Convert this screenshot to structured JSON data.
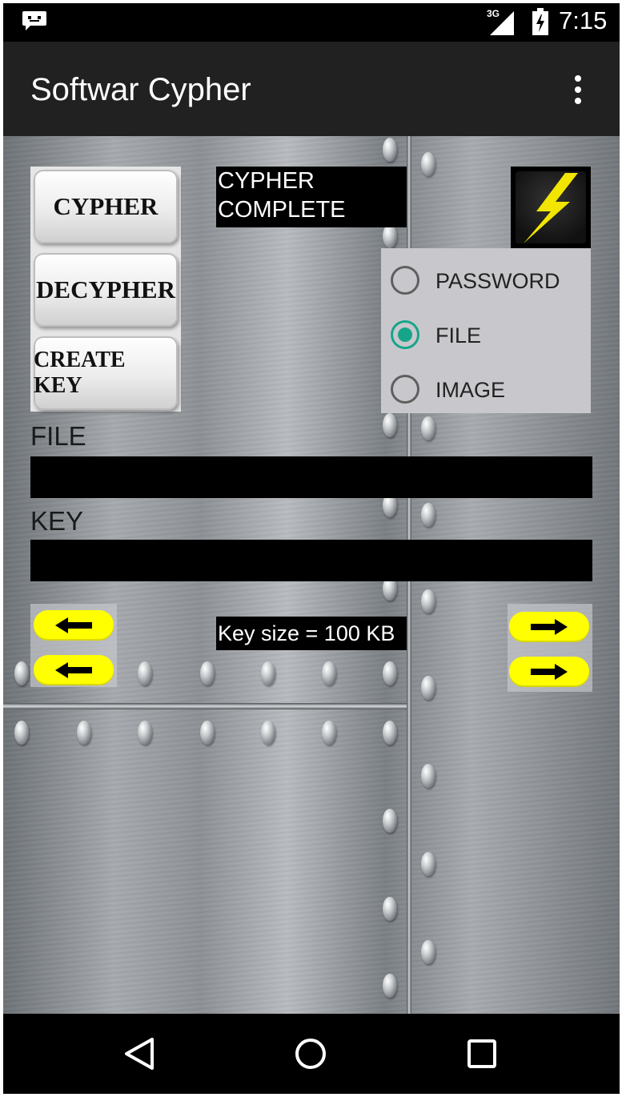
{
  "status_bar": {
    "network": "3G",
    "time": "7:15",
    "notification_icon": "messenger-icon",
    "signal_icon": "signal-icon",
    "battery_icon": "battery-charging-icon"
  },
  "app_bar": {
    "title": "Softwar Cypher",
    "overflow_icon": "overflow-menu-icon"
  },
  "actions": {
    "cypher_label": "CYPHER",
    "decypher_label": "DECYPHER",
    "create_key_label": "CREATE KEY"
  },
  "status": {
    "line1": "CYPHER",
    "line2": "COMPLETE"
  },
  "execute_icon": "lightning-icon",
  "mode": {
    "options": [
      "PASSWORD",
      "FILE",
      "IMAGE"
    ],
    "selected": "FILE"
  },
  "file_field": {
    "label": "FILE",
    "value": ""
  },
  "key_field": {
    "label": "KEY",
    "value": ""
  },
  "key_size_text": "Key size = 100 KB",
  "navigation": {
    "back_icon": "back-triangle-icon",
    "home_icon": "home-circle-icon",
    "recents_icon": "recents-square-icon"
  },
  "colors": {
    "app_bar": "#212121",
    "radio_accent": "#17a58a",
    "arrow_button": "#ffff00",
    "bolt": "#f2e600"
  }
}
